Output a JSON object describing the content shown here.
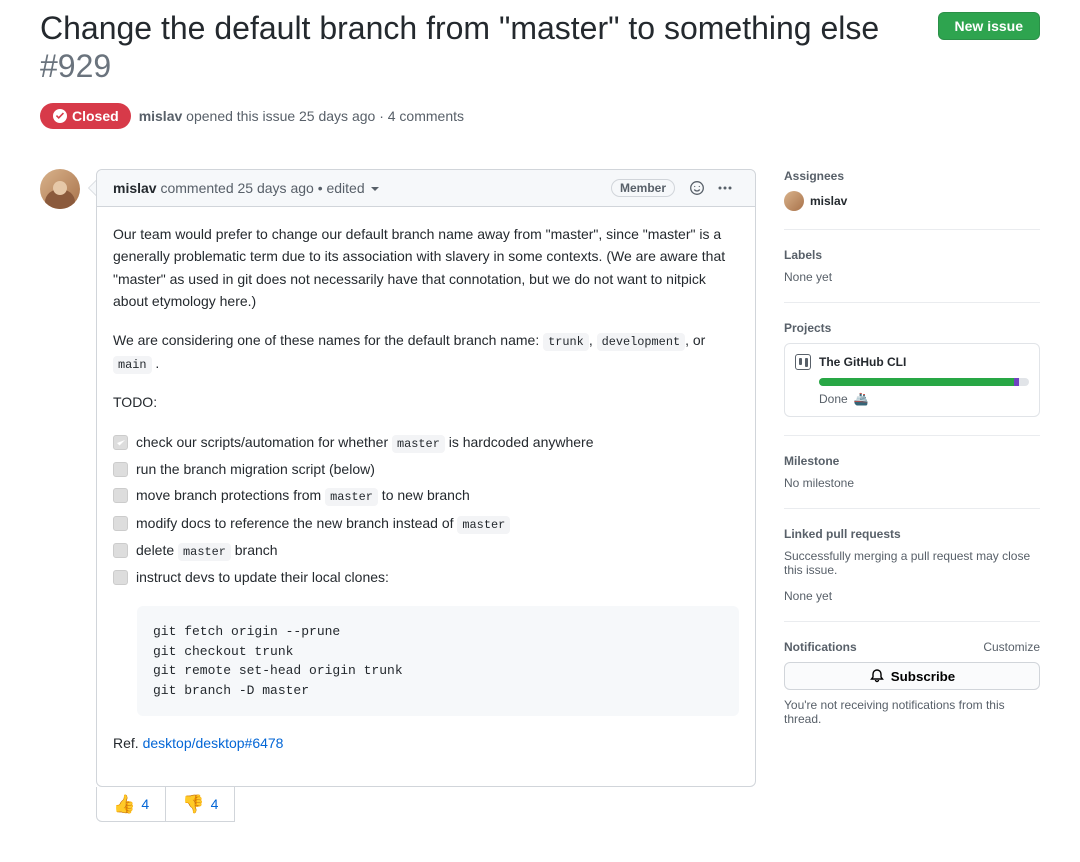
{
  "header": {
    "title": "Change the default branch from \"master\" to something else",
    "issue_number": "#929",
    "new_issue_label": "New issue",
    "state_label": "Closed",
    "author": "mislav",
    "opened_text": " opened this issue 25 days ago · 4 comments"
  },
  "comment": {
    "author": "mislav",
    "meta": " commented 25 days ago • edited ",
    "badge": "Member",
    "p1": "Our team would prefer to change our default branch name away from \"master\", since \"master\" is a generally problematic term due to its association with slavery in some contexts. (We are aware that \"master\" as used in git does not necessarily have that connotation, but we do not want to nitpick about etymology here.)",
    "p2_a": "We are considering one of these names for the default branch name: ",
    "p2_c1": "trunk",
    "p2_sep1": ", ",
    "p2_c2": "development",
    "p2_sep2": ", or ",
    "p2_c3": "main",
    "p2_tail": " .",
    "todo_label": "TODO:",
    "tasks": [
      {
        "pre": "check our scripts/automation for whether ",
        "code": "master",
        "post": " is hardcoded anywhere"
      },
      {
        "pre": "run the branch migration script (below)",
        "code": "",
        "post": ""
      },
      {
        "pre": "move branch protections from ",
        "code": "master",
        "post": " to new branch"
      },
      {
        "pre": "modify docs to reference the new branch instead of ",
        "code": "master",
        "post": ""
      },
      {
        "pre": "delete ",
        "code": "master",
        "post": " branch"
      },
      {
        "pre": "instruct devs to update their local clones:",
        "code": "",
        "post": ""
      }
    ],
    "codeblock": "git fetch origin --prune\ngit checkout trunk\ngit remote set-head origin trunk\ngit branch -D master",
    "ref_label": "Ref. ",
    "ref_link": "desktop/desktop#6478",
    "reaction_up": "4",
    "reaction_down": "4"
  },
  "sidebar": {
    "assignees_title": "Assignees",
    "assignee_name": "mislav",
    "labels_title": "Labels",
    "labels_value": "None yet",
    "projects_title": "Projects",
    "project_name": "The GitHub CLI",
    "project_status": "Done",
    "milestone_title": "Milestone",
    "milestone_value": "No milestone",
    "linked_pr_title": "Linked pull requests",
    "linked_pr_desc": "Successfully merging a pull request may close this issue.",
    "linked_pr_value": "None yet",
    "notifications_title": "Notifications",
    "customize_label": "Customize",
    "subscribe_label": "Subscribe",
    "notifications_desc": "You're not receiving notifications from this thread."
  }
}
